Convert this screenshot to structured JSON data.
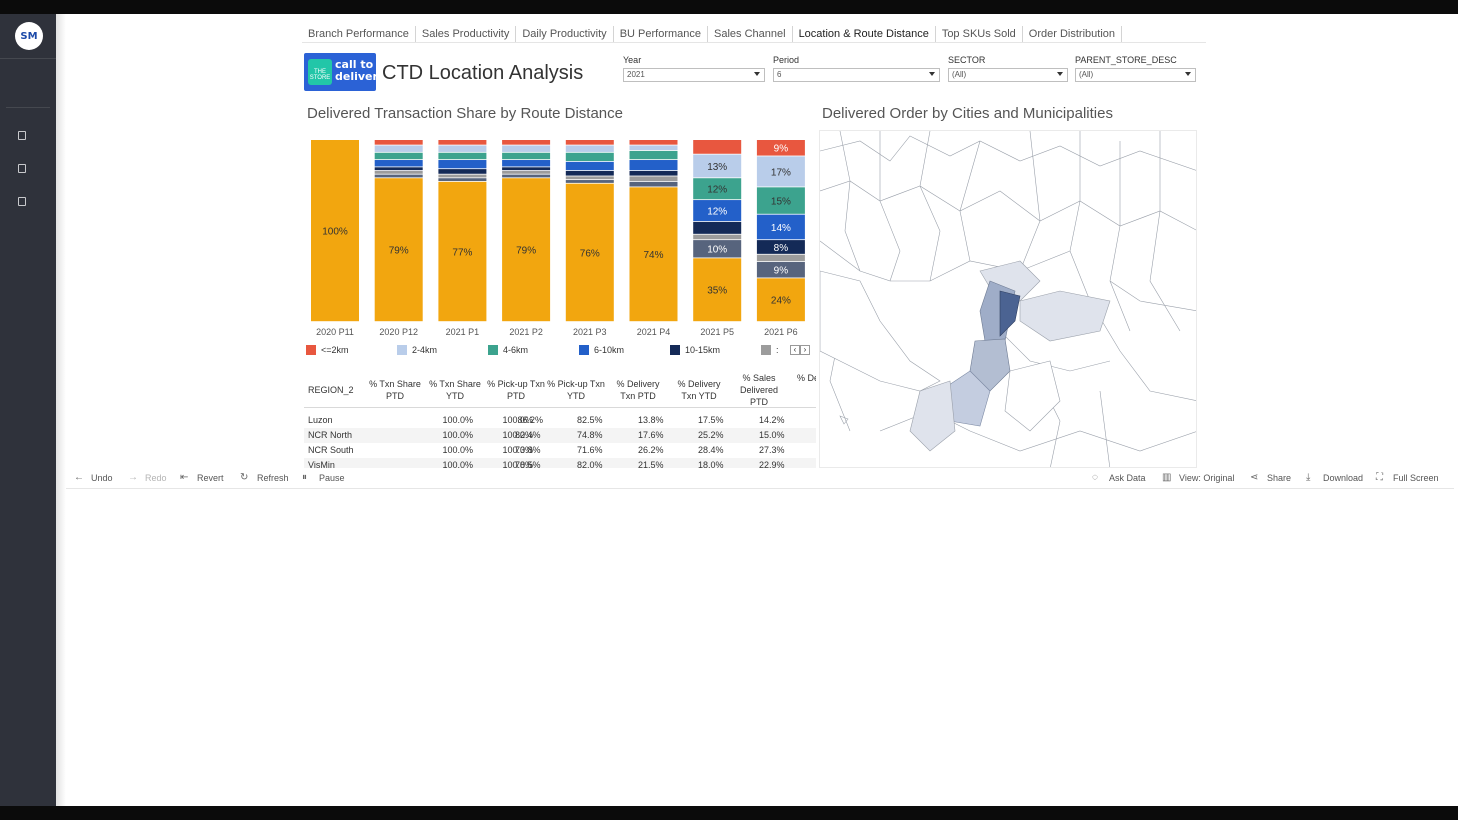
{
  "sidebar": {
    "logo_text": "SM"
  },
  "tabs": [
    {
      "label": "Branch Performance"
    },
    {
      "label": "Sales Productivity"
    },
    {
      "label": "Daily Productivity"
    },
    {
      "label": "BU Performance"
    },
    {
      "label": "Sales Channel"
    },
    {
      "label": "Location & Route Distance",
      "active": true
    },
    {
      "label": "Top SKUs Sold"
    },
    {
      "label": "Order Distribution"
    }
  ],
  "header": {
    "logo_small": "THE STORE",
    "logo_line1": "call to",
    "logo_line2": "deliver",
    "title": "CTD Location Analysis"
  },
  "filters": {
    "year": {
      "label": "Year",
      "value": "2021"
    },
    "period": {
      "label": "Period",
      "value": "6"
    },
    "sector": {
      "label": "SECTOR",
      "value": "(All)"
    },
    "parent_store": {
      "label": "PARENT_STORE_DESC",
      "value": "(All)"
    }
  },
  "sections": {
    "bar_title": "Delivered Transaction Share by Route Distance",
    "map_title": "Delivered Order by Cities and Municipalities"
  },
  "chart_data": {
    "type": "bar",
    "stacked": true,
    "categories": [
      "2020 P11",
      "2020 P12",
      "2021 P1",
      "2021 P2",
      "2021 P3",
      "2021 P4",
      "2021 P5",
      "2021 P6"
    ],
    "series": [
      {
        "name": "<=2km",
        "color": "#e8573f",
        "values": [
          0,
          3,
          3,
          3,
          3,
          3,
          8,
          9
        ]
      },
      {
        "name": "2-4km",
        "color": "#b9cdea",
        "values": [
          0,
          4,
          4,
          4,
          4,
          3,
          13,
          17
        ]
      },
      {
        "name": "4-6km",
        "color": "#3ca38e",
        "values": [
          0,
          4,
          4,
          4,
          5,
          5,
          12,
          15
        ]
      },
      {
        "name": "6-10km",
        "color": "#2360c9",
        "values": [
          0,
          4,
          5,
          4,
          5,
          6,
          12,
          14
        ]
      },
      {
        "name": "10-15km",
        "color": "#142a57",
        "values": [
          0,
          2,
          3,
          2,
          3,
          3,
          7,
          8
        ]
      },
      {
        "name": "",
        "color": "#9c9c9c",
        "values": [
          0,
          2,
          2,
          2,
          2,
          3,
          3,
          4
        ]
      },
      {
        "name": "",
        "color": "#57647d",
        "values": [
          0,
          2,
          2,
          2,
          2,
          3,
          10,
          9
        ]
      },
      {
        "name": "",
        "color": "#f2a60f",
        "values": [
          100,
          79,
          77,
          79,
          76,
          74,
          35,
          24
        ]
      }
    ],
    "labels": [
      {
        "cat": 0,
        "series": 7,
        "text": "100%"
      },
      {
        "cat": 1,
        "series": 7,
        "text": "79%"
      },
      {
        "cat": 2,
        "series": 7,
        "text": "77%"
      },
      {
        "cat": 3,
        "series": 7,
        "text": "79%"
      },
      {
        "cat": 4,
        "series": 7,
        "text": "76%"
      },
      {
        "cat": 5,
        "series": 7,
        "text": "74%"
      },
      {
        "cat": 6,
        "series": 1,
        "text": "13%"
      },
      {
        "cat": 6,
        "series": 2,
        "text": "12%"
      },
      {
        "cat": 6,
        "series": 3,
        "text": "12%"
      },
      {
        "cat": 6,
        "series": 6,
        "text": "10%"
      },
      {
        "cat": 6,
        "series": 7,
        "text": "35%"
      },
      {
        "cat": 7,
        "series": 0,
        "text": "9%"
      },
      {
        "cat": 7,
        "series": 1,
        "text": "17%"
      },
      {
        "cat": 7,
        "series": 2,
        "text": "15%"
      },
      {
        "cat": 7,
        "series": 3,
        "text": "14%"
      },
      {
        "cat": 7,
        "series": 4,
        "text": "8%"
      },
      {
        "cat": 7,
        "series": 6,
        "text": "9%"
      },
      {
        "cat": 7,
        "series": 7,
        "text": "24%"
      }
    ],
    "ylim": [
      0,
      100
    ]
  },
  "legend_extra": ":",
  "table": {
    "headers": [
      "REGION_2",
      "% Txn Share PTD",
      "% Txn Share YTD",
      "% Pick-up Txn PTD",
      "% Pick-up Txn YTD",
      "% Delivery Txn PTD",
      "% Delivery Txn YTD",
      "% Sales Delivered PTD",
      "% Del"
    ],
    "rows": [
      [
        "Luzon",
        "100.0%",
        "100.0%",
        "86.2%",
        "82.5%",
        "13.8%",
        "17.5%",
        "14.2%"
      ],
      [
        "NCR North",
        "100.0%",
        "100.0%",
        "82.4%",
        "74.8%",
        "17.6%",
        "25.2%",
        "15.0%"
      ],
      [
        "NCR South",
        "100.0%",
        "100.0%",
        "73.8%",
        "71.6%",
        "26.2%",
        "28.4%",
        "27.3%"
      ],
      [
        "VisMin",
        "100.0%",
        "100.0%",
        "78.5%",
        "82.0%",
        "21.5%",
        "18.0%",
        "22.9%"
      ]
    ]
  },
  "toolbar": {
    "undo": "Undo",
    "redo": "Redo",
    "revert": "Revert",
    "refresh": "Refresh",
    "pause": "Pause",
    "ask_data": "Ask Data",
    "view": "View: Original",
    "share": "Share",
    "download": "Download",
    "full_screen": "Full Screen"
  }
}
